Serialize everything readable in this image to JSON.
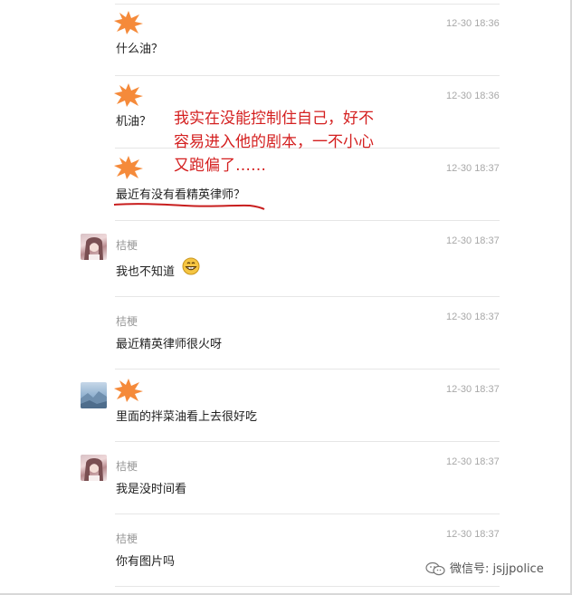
{
  "messages": [
    {
      "name": "",
      "time": "12-30 18:36",
      "text": "什么油？",
      "avatar": "masked"
    },
    {
      "name": "",
      "time": "12-30 18:36",
      "text": "机油？",
      "avatar": "masked"
    },
    {
      "name": "",
      "time": "12-30 18:37",
      "text": "最近有没有看精英律师？",
      "avatar": "masked"
    },
    {
      "name": "桔梗",
      "time": "12-30 18:37",
      "text": "我也不知道",
      "avatar": "girl-photo",
      "emoji": "grin-emoji"
    },
    {
      "name": "桔梗",
      "time": "12-30 18:37",
      "text": "最近精英律师很火呀",
      "avatar": "none"
    },
    {
      "name": "",
      "time": "12-30 18:37",
      "text": "里面的拌菜油看上去很好吃",
      "avatar": "sky-photo"
    },
    {
      "name": "桔梗",
      "time": "12-30 18:37",
      "text": "我是没时间看",
      "avatar": "girl-photo"
    },
    {
      "name": "桔梗",
      "time": "12-30 18:37",
      "text": "你有图片吗",
      "avatar": "none"
    }
  ],
  "annotation": {
    "line1": "我实在没能控制住自己，好不",
    "line2": "容易进入他的剧本，一不小心",
    "line3": "又跑偏了……",
    "color": "#d42020"
  },
  "watermark": {
    "icon": "wechat-icon",
    "text": "微信号: jsjjpolice"
  },
  "colors": {
    "mask": "#f58a3a",
    "annotation": "#d42020"
  }
}
